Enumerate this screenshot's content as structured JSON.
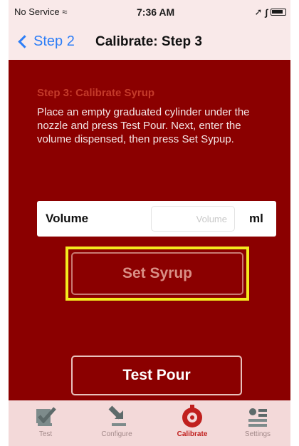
{
  "status_bar": {
    "carrier": "No Service",
    "time": "7:36 AM"
  },
  "nav": {
    "back_label": "Step 2",
    "title": "Calibrate: Step 3"
  },
  "step": {
    "heading": "Step 3: Calibrate Syrup",
    "description": "Place an empty graduated cylinder under the nozzle and press Test Pour. Next, enter the volume dispensed, then press Set Sypup."
  },
  "volume": {
    "label": "Volume",
    "placeholder": "Volume",
    "value": "",
    "unit": "ml"
  },
  "buttons": {
    "set_syrup": "Set Syrup",
    "test_pour": "Test Pour"
  },
  "tabs": [
    {
      "label": "Test",
      "icon": "checkbox-check-icon",
      "active": false
    },
    {
      "label": "Configure",
      "icon": "arrow-down-right-icon",
      "active": false
    },
    {
      "label": "Calibrate",
      "icon": "gauge-dial-icon",
      "active": true
    },
    {
      "label": "Settings",
      "icon": "settings-list-icon",
      "active": false
    }
  ],
  "colors": {
    "content_bg": "#8b0000",
    "tab_bar_bg": "#f3d9d9",
    "accent_blue": "#2d7ef7",
    "highlight": "#f4ea1e",
    "active_tab": "#c0201e"
  }
}
